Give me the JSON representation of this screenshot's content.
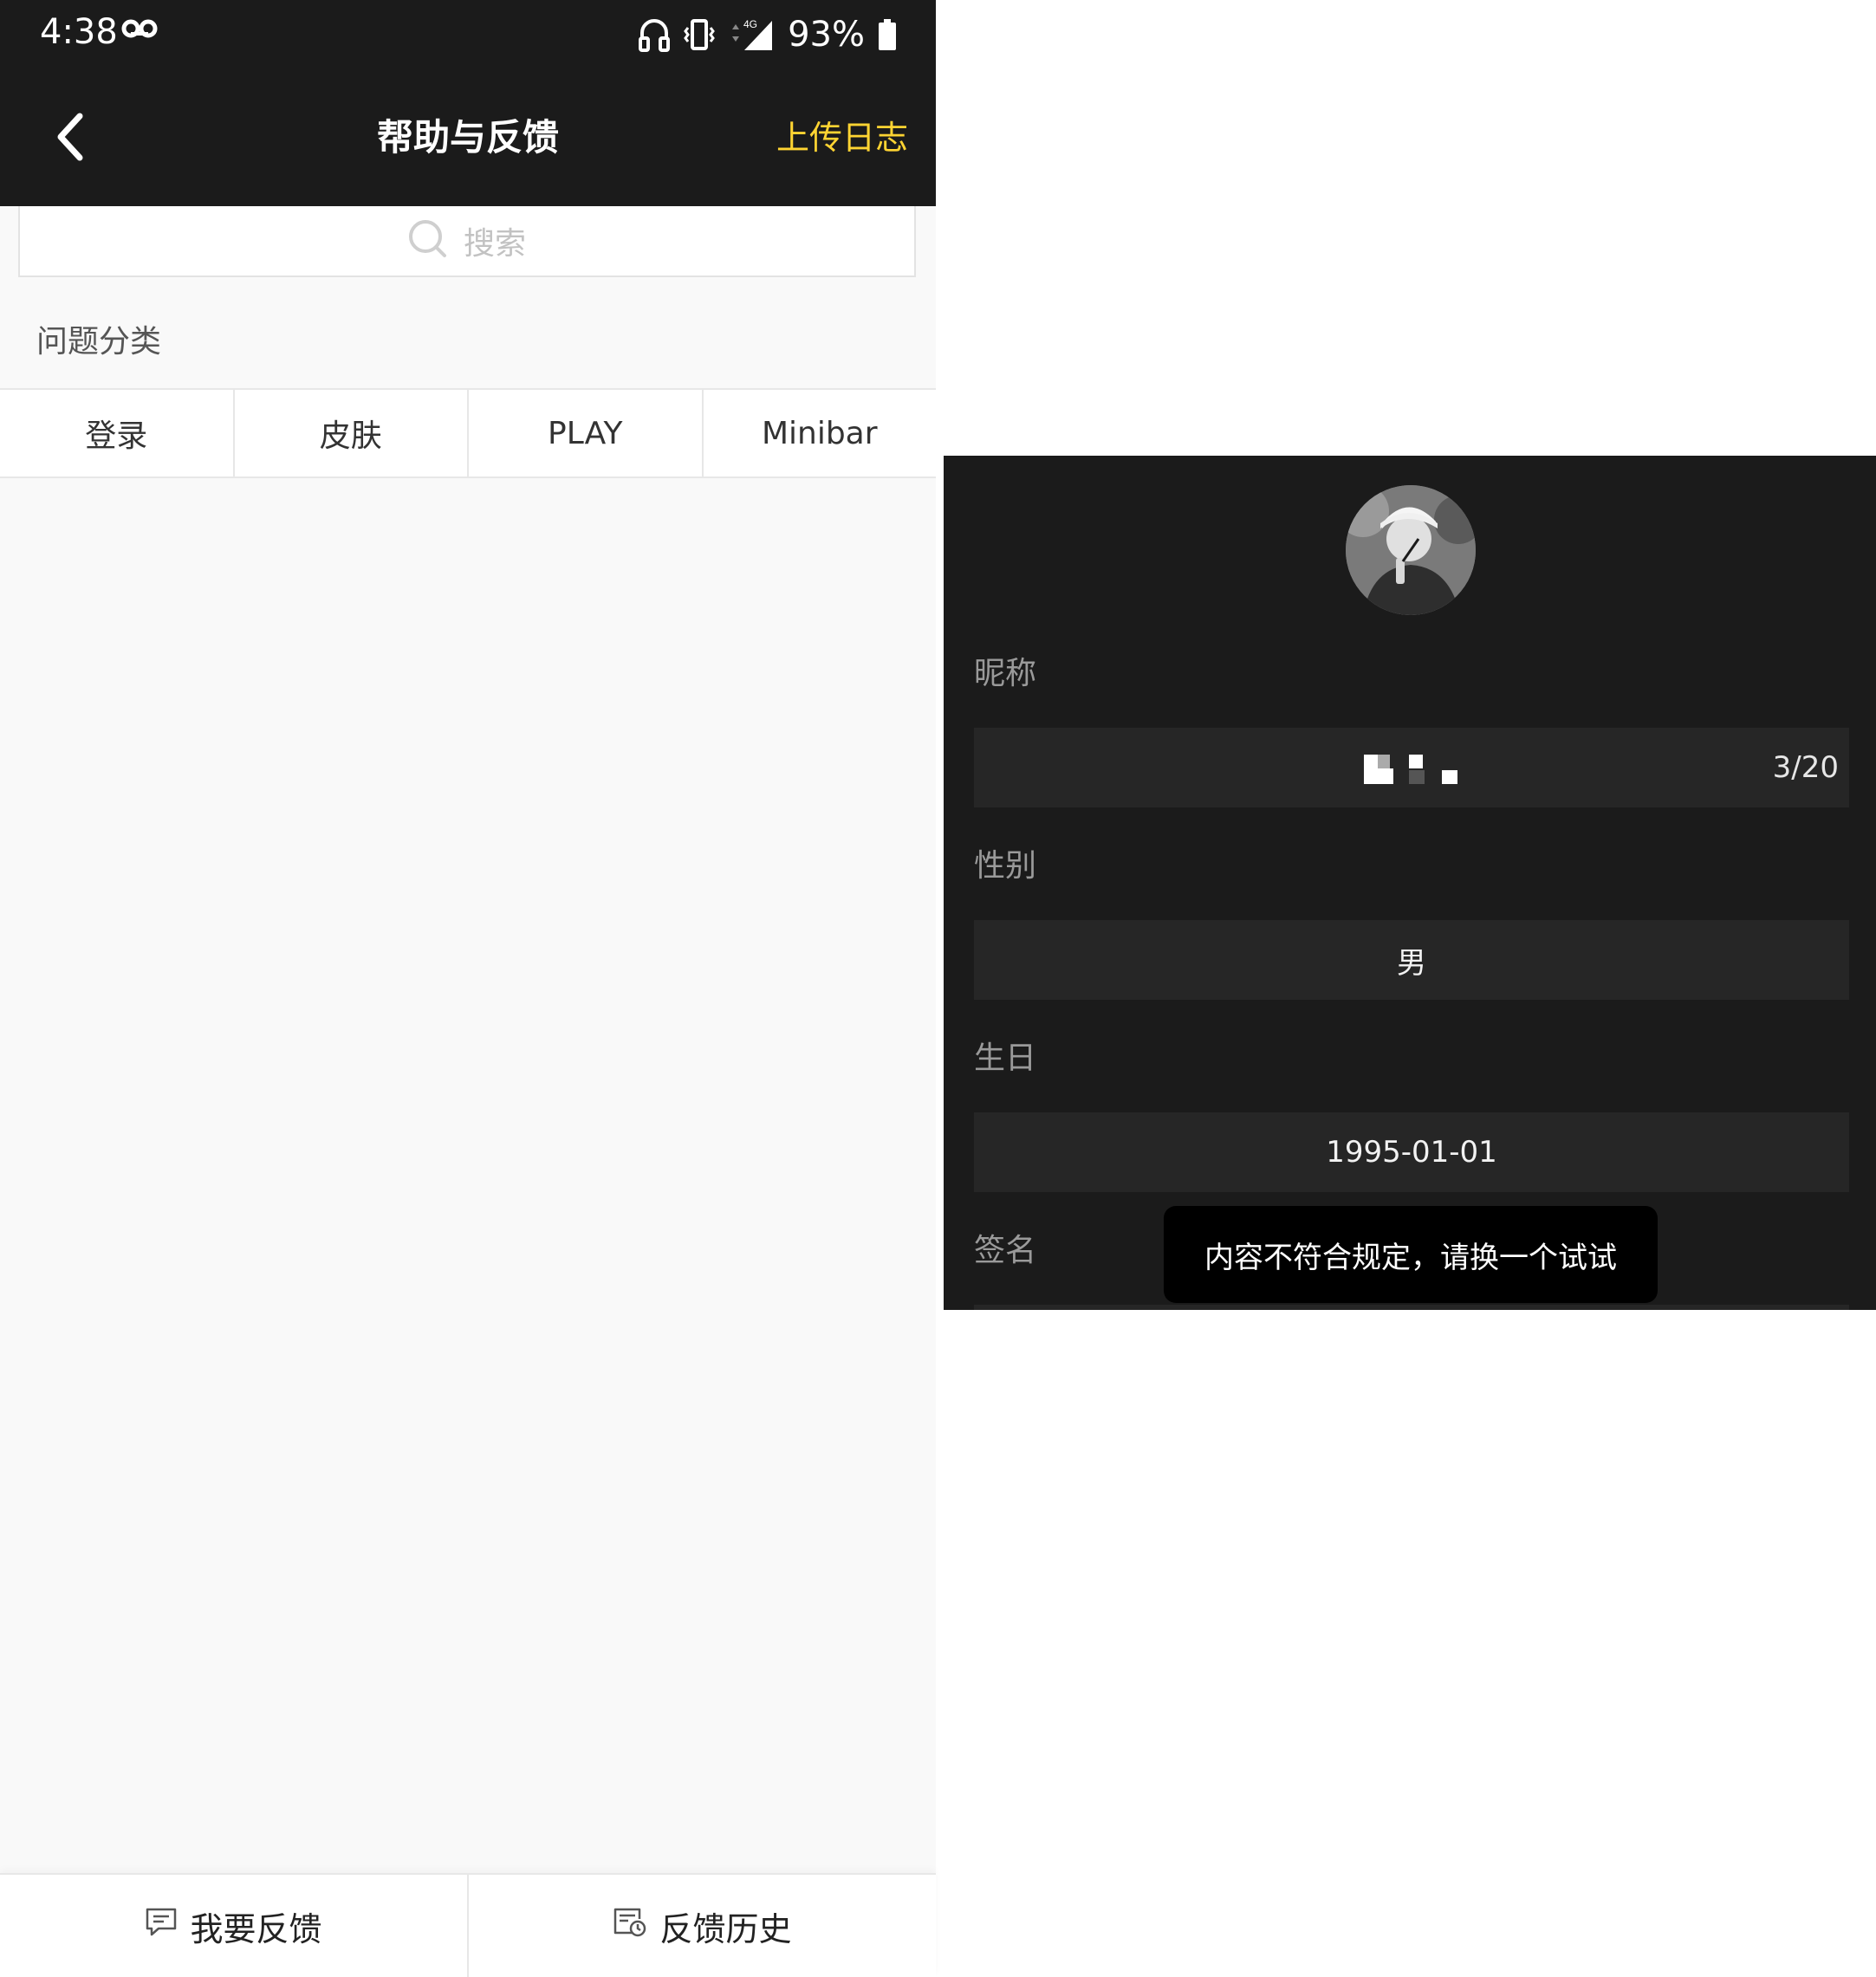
{
  "left": {
    "status_bar": {
      "time": "4:38",
      "battery": "93%",
      "network": "4G"
    },
    "header": {
      "title": "帮助与反馈",
      "action": "上传日志",
      "action_color": "#ffd432"
    },
    "search": {
      "placeholder": "搜索"
    },
    "section": {
      "label": "问题分类"
    },
    "categories": [
      "登录",
      "皮肤",
      "PLAY",
      "Minibar"
    ],
    "bottom_tabs": {
      "feedback": "我要反馈",
      "history": "反馈历史"
    }
  },
  "right": {
    "nickname": {
      "label": "昵称",
      "count": "3/20"
    },
    "gender": {
      "label": "性别",
      "value": "男"
    },
    "birthday": {
      "label": "生日",
      "value": "1995-01-01"
    },
    "signature": {
      "label": "签名"
    },
    "toast": "内容不符合规定，请换一个试试"
  },
  "icons": [
    "back-icon",
    "search-icon",
    "headphones-icon",
    "vibrate-icon",
    "signal-icon",
    "battery-icon",
    "voicemail-icon",
    "feedback-icon",
    "history-icon"
  ]
}
